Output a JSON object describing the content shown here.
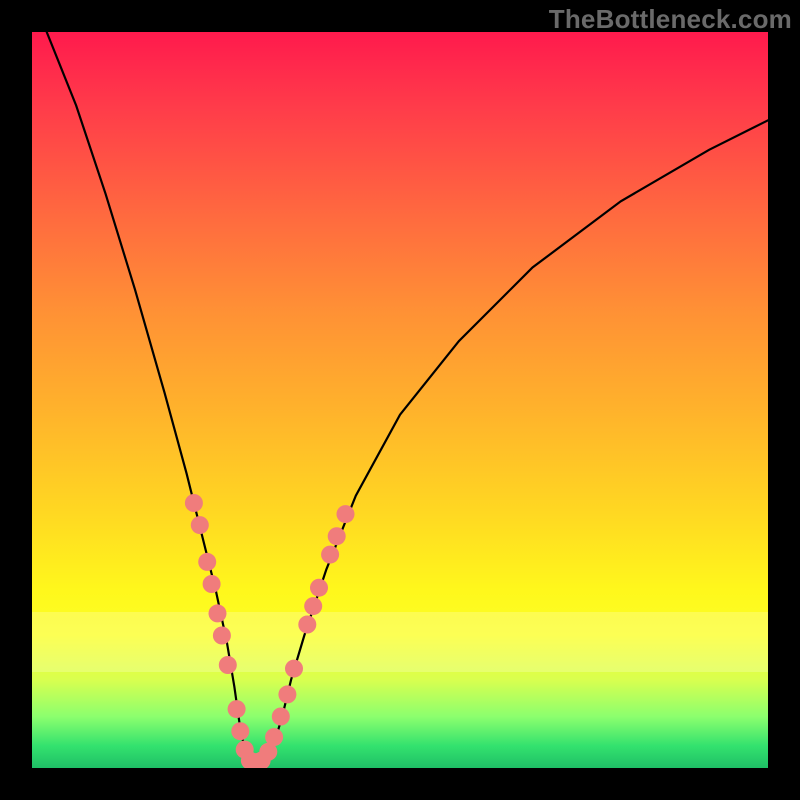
{
  "watermark": "TheBottleneck.com",
  "chart_data": {
    "type": "line",
    "title": "",
    "xlabel": "",
    "ylabel": "",
    "xlim": [
      0,
      100
    ],
    "ylim": [
      0,
      100
    ],
    "series": [
      {
        "name": "curve",
        "x": [
          2,
          6,
          10,
          14,
          18,
          21,
          23,
          25,
          26.5,
          27.5,
          28.2,
          28.9,
          29.7,
          31.2,
          32.8,
          34,
          35.2,
          37,
          40,
          44,
          50,
          58,
          68,
          80,
          92,
          100
        ],
        "values": [
          100,
          90,
          78,
          65,
          51,
          40,
          32,
          24,
          17,
          11,
          6,
          2.5,
          0.8,
          0.8,
          3,
          7,
          12,
          18,
          27,
          37,
          48,
          58,
          68,
          77,
          84,
          88
        ]
      }
    ],
    "markers": [
      {
        "x": 22.0,
        "y": 36
      },
      {
        "x": 22.8,
        "y": 33
      },
      {
        "x": 23.8,
        "y": 28
      },
      {
        "x": 24.4,
        "y": 25
      },
      {
        "x": 25.2,
        "y": 21
      },
      {
        "x": 25.8,
        "y": 18
      },
      {
        "x": 26.6,
        "y": 14
      },
      {
        "x": 27.8,
        "y": 8
      },
      {
        "x": 28.3,
        "y": 5
      },
      {
        "x": 28.9,
        "y": 2.5
      },
      {
        "x": 29.6,
        "y": 1.0
      },
      {
        "x": 30.4,
        "y": 0.8
      },
      {
        "x": 31.2,
        "y": 1.0
      },
      {
        "x": 32.1,
        "y": 2.2
      },
      {
        "x": 32.9,
        "y": 4.2
      },
      {
        "x": 33.8,
        "y": 7
      },
      {
        "x": 34.7,
        "y": 10
      },
      {
        "x": 35.6,
        "y": 13.5
      },
      {
        "x": 37.4,
        "y": 19.5
      },
      {
        "x": 38.2,
        "y": 22
      },
      {
        "x": 39.0,
        "y": 24.5
      },
      {
        "x": 40.5,
        "y": 29
      },
      {
        "x": 41.4,
        "y": 31.5
      },
      {
        "x": 42.6,
        "y": 34.5
      }
    ]
  }
}
